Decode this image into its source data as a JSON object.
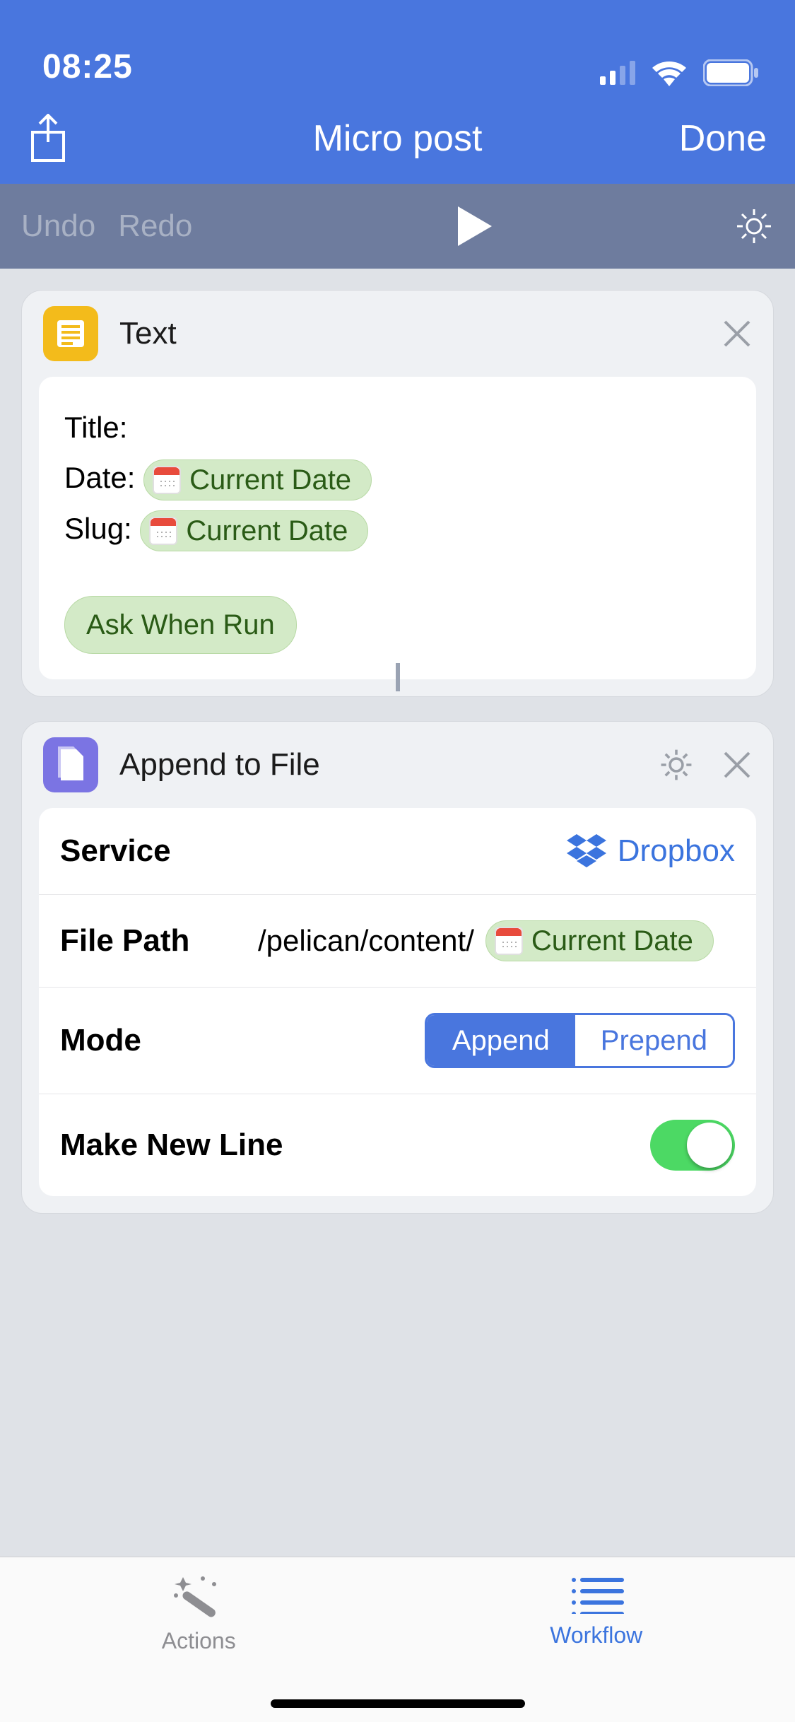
{
  "status": {
    "time": "08:25"
  },
  "nav": {
    "title": "Micro post",
    "done": "Done"
  },
  "toolbar": {
    "undo": "Undo",
    "redo": "Redo"
  },
  "text_action": {
    "name": "Text",
    "fields": {
      "title_label": "Title:",
      "date_label": "Date:",
      "slug_label": "Slug:"
    },
    "tokens": {
      "current_date": "Current Date",
      "ask_when_run": "Ask When Run"
    }
  },
  "append_action": {
    "name": "Append to File",
    "rows": {
      "service_label": "Service",
      "service_value": "Dropbox",
      "filepath_label": "File Path",
      "filepath_prefix": "/pelican/content/",
      "filepath_token": "Current Date",
      "mode_label": "Mode",
      "mode_options": {
        "append": "Append",
        "prepend": "Prepend"
      },
      "newline_label": "Make New Line"
    }
  },
  "tabs": {
    "actions": "Actions",
    "workflow": "Workflow"
  }
}
